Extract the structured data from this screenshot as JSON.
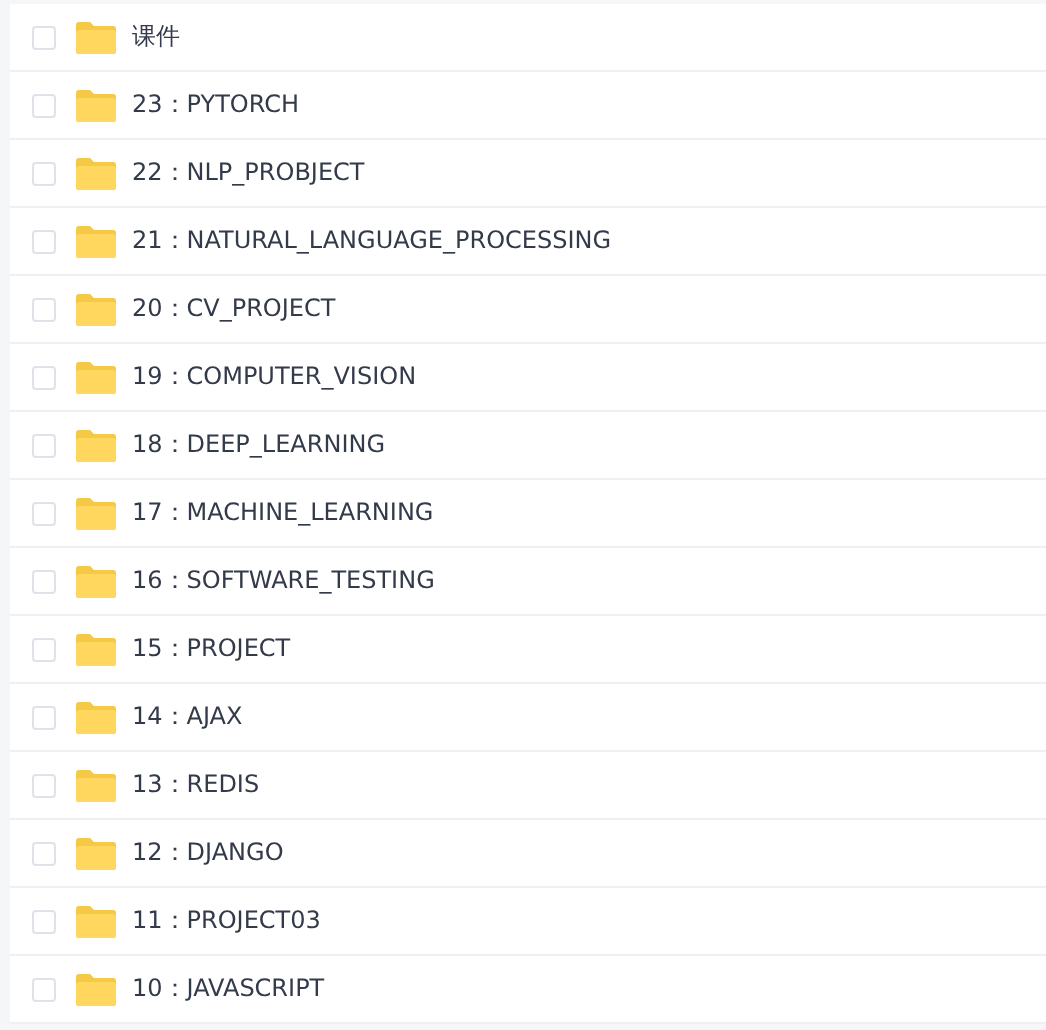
{
  "files": [
    {
      "name": "课件",
      "checked": false
    },
    {
      "name": "23：PYTORCH",
      "checked": false
    },
    {
      "name": "22：NLP_PROBJECT",
      "checked": false
    },
    {
      "name": "21：NATURAL_LANGUAGE_PROCESSING",
      "checked": false
    },
    {
      "name": "20：CV_PROJECT",
      "checked": false
    },
    {
      "name": "19：COMPUTER_VISION",
      "checked": false
    },
    {
      "name": "18：DEEP_LEARNING",
      "checked": false
    },
    {
      "name": "17：MACHINE_LEARNING",
      "checked": false
    },
    {
      "name": "16：SOFTWARE_TESTING",
      "checked": false
    },
    {
      "name": "15：PROJECT",
      "checked": false
    },
    {
      "name": "14：AJAX",
      "checked": false
    },
    {
      "name": "13：REDIS",
      "checked": false
    },
    {
      "name": "12：DJANGO",
      "checked": false
    },
    {
      "name": "11：PROJECT03",
      "checked": false
    },
    {
      "name": "10：JAVASCRIPT",
      "checked": false
    }
  ]
}
